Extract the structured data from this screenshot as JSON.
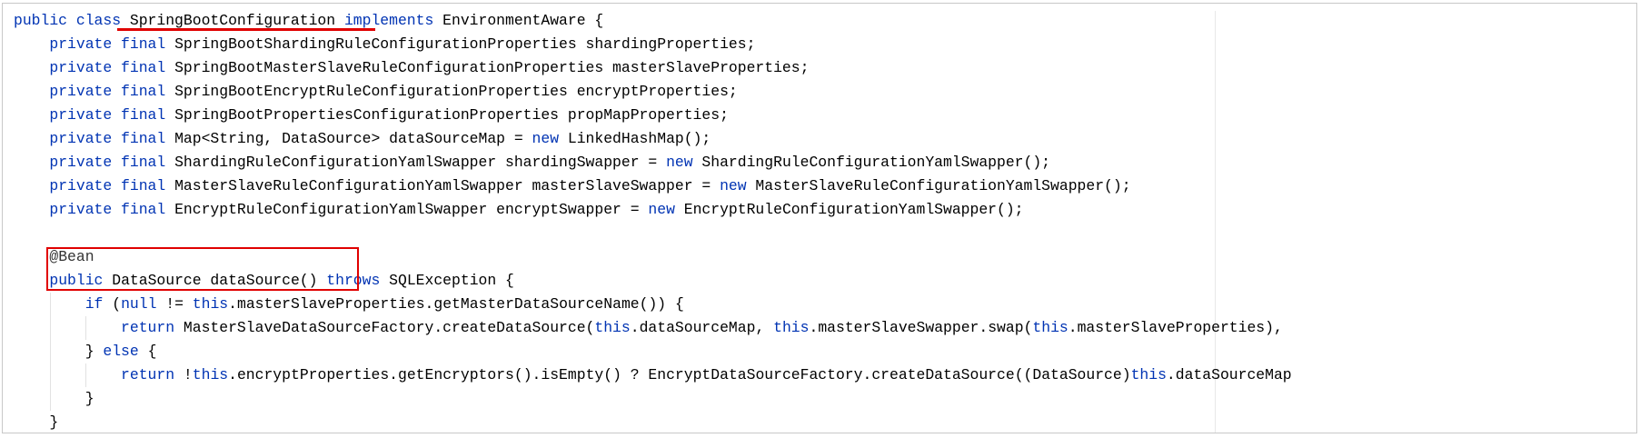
{
  "editor": {
    "lines": [
      [
        {
          "t": "public class ",
          "k": "kw"
        },
        {
          "t": "SpringBootConfiguration",
          "k": ""
        },
        {
          "t": " "
        },
        {
          "t": "implements",
          "k": "kw"
        },
        {
          "t": " EnvironmentAware {"
        }
      ],
      [
        {
          "t": "    "
        },
        {
          "t": "private final",
          "k": "kw"
        },
        {
          "t": " SpringBootShardingRuleConfigurationProperties shardingProperties;"
        }
      ],
      [
        {
          "t": "    "
        },
        {
          "t": "private final",
          "k": "kw"
        },
        {
          "t": " SpringBootMasterSlaveRuleConfigurationProperties masterSlaveProperties;"
        }
      ],
      [
        {
          "t": "    "
        },
        {
          "t": "private final",
          "k": "kw"
        },
        {
          "t": " SpringBootEncryptRuleConfigurationProperties encryptProperties;"
        }
      ],
      [
        {
          "t": "    "
        },
        {
          "t": "private final",
          "k": "kw"
        },
        {
          "t": " SpringBootPropertiesConfigurationProperties propMapProperties;"
        }
      ],
      [
        {
          "t": "    "
        },
        {
          "t": "private final",
          "k": "kw"
        },
        {
          "t": " Map<String, DataSource> dataSourceMap = "
        },
        {
          "t": "new",
          "k": "kw"
        },
        {
          "t": " LinkedHashMap();"
        }
      ],
      [
        {
          "t": "    "
        },
        {
          "t": "private final",
          "k": "kw"
        },
        {
          "t": " ShardingRuleConfigurationYamlSwapper shardingSwapper = "
        },
        {
          "t": "new",
          "k": "kw"
        },
        {
          "t": " ShardingRuleConfigurationYamlSwapper();"
        }
      ],
      [
        {
          "t": "    "
        },
        {
          "t": "private final",
          "k": "kw"
        },
        {
          "t": " MasterSlaveRuleConfigurationYamlSwapper masterSlaveSwapper = "
        },
        {
          "t": "new",
          "k": "kw"
        },
        {
          "t": " MasterSlaveRuleConfigurationYamlSwapper();"
        }
      ],
      [
        {
          "t": "    "
        },
        {
          "t": "private final",
          "k": "kw"
        },
        {
          "t": " EncryptRuleConfigurationYamlSwapper encryptSwapper = "
        },
        {
          "t": "new",
          "k": "kw"
        },
        {
          "t": " EncryptRuleConfigurationYamlSwapper();"
        }
      ],
      [
        {
          "t": ""
        }
      ],
      [
        {
          "t": "    "
        },
        {
          "t": "@Bean",
          "k": "anno"
        }
      ],
      [
        {
          "t": "    "
        },
        {
          "t": "public",
          "k": "kw"
        },
        {
          "t": " DataSource dataSource() "
        },
        {
          "t": "throws",
          "k": "kw"
        },
        {
          "t": " SQLException {"
        }
      ],
      [
        {
          "t": "        "
        },
        {
          "t": "if",
          "k": "kw"
        },
        {
          "t": " ("
        },
        {
          "t": "null",
          "k": "kw"
        },
        {
          "t": " != "
        },
        {
          "t": "this",
          "k": "kw"
        },
        {
          "t": ".masterSlaveProperties.getMasterDataSourceName()) {"
        }
      ],
      [
        {
          "t": "            "
        },
        {
          "t": "return",
          "k": "kw"
        },
        {
          "t": " MasterSlaveDataSourceFactory.createDataSource("
        },
        {
          "t": "this",
          "k": "kw"
        },
        {
          "t": ".dataSourceMap, "
        },
        {
          "t": "this",
          "k": "kw"
        },
        {
          "t": ".masterSlaveSwapper.swap("
        },
        {
          "t": "this",
          "k": "kw"
        },
        {
          "t": ".masterSlaveProperties),"
        }
      ],
      [
        {
          "t": "        } "
        },
        {
          "t": "else",
          "k": "kw"
        },
        {
          "t": " {"
        }
      ],
      [
        {
          "t": "            "
        },
        {
          "t": "return",
          "k": "kw"
        },
        {
          "t": " !"
        },
        {
          "t": "this",
          "k": "kw"
        },
        {
          "t": ".encryptProperties.getEncryptors().isEmpty() ? EncryptDataSourceFactory.createDataSource((DataSource)"
        },
        {
          "t": "this",
          "k": "kw"
        },
        {
          "t": ".dataSourceMap"
        }
      ],
      [
        {
          "t": "        }"
        }
      ],
      [
        {
          "t": "    }"
        }
      ]
    ]
  },
  "annotations": {
    "underline_target": "SpringBootConfiguration",
    "box_target": "@Bean public DataSource dataSource()",
    "color": "#e00000"
  },
  "colors": {
    "keyword": "#0033b3",
    "text": "#000000",
    "border": "#c8c8c8"
  }
}
